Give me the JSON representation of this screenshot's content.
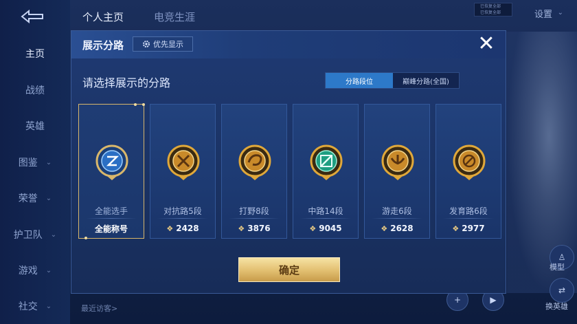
{
  "background": {
    "top_tabs": [
      "个人主页",
      "电竞生涯"
    ],
    "settings_label": "设置",
    "notice_lines": [
      "已恢复全部",
      "已恢复全部"
    ],
    "sidebar": [
      {
        "label": "主页",
        "active": true,
        "has_chevron": false
      },
      {
        "label": "战绩",
        "active": false,
        "has_chevron": false
      },
      {
        "label": "英雄",
        "active": false,
        "has_chevron": false
      },
      {
        "label": "图鉴",
        "active": false,
        "has_chevron": true
      },
      {
        "label": "荣誉",
        "active": false,
        "has_chevron": true
      },
      {
        "label": "护卫队",
        "active": false,
        "has_chevron": true
      },
      {
        "label": "游戏",
        "active": false,
        "has_chevron": true
      },
      {
        "label": "社交",
        "active": false,
        "has_chevron": true
      }
    ],
    "recent_visitors": "最近访客>",
    "float_buttons": [
      {
        "label": "模型",
        "icon": "figure-icon"
      },
      {
        "label": "换英雄",
        "icon": "swap-hero-icon"
      }
    ]
  },
  "modal": {
    "title": "展示分路",
    "priority_button": "优先显示",
    "close_icon": "close-icon",
    "subtitle": "请选择展示的分路",
    "segments": [
      {
        "label": "分路段位",
        "active": true
      },
      {
        "label": "巅峰分路(全国)",
        "active": false
      }
    ],
    "cards": [
      {
        "name": "全能选手",
        "score": "全能称号",
        "selected": true,
        "emblem": "all-round-emblem-icon",
        "emblem_color": "#4aa3e8"
      },
      {
        "name": "对抗路5段",
        "score": "2428",
        "selected": false,
        "emblem": "clash-lane-emblem-icon",
        "emblem_color": "#e0a83a"
      },
      {
        "name": "打野8段",
        "score": "3876",
        "selected": false,
        "emblem": "jungle-emblem-icon",
        "emblem_color": "#e0a83a"
      },
      {
        "name": "中路14段",
        "score": "9045",
        "selected": false,
        "emblem": "mid-lane-emblem-icon",
        "emblem_color": "#3fd0a8"
      },
      {
        "name": "游走6段",
        "score": "2628",
        "selected": false,
        "emblem": "roam-emblem-icon",
        "emblem_color": "#e0a83a"
      },
      {
        "name": "发育路6段",
        "score": "2977",
        "selected": false,
        "emblem": "farm-lane-emblem-icon",
        "emblem_color": "#e0a83a"
      }
    ],
    "confirm_button": "确定"
  },
  "colors": {
    "gold": "#e4c274",
    "accent_blue": "#2d79c9",
    "panel": "#1f3a73"
  }
}
